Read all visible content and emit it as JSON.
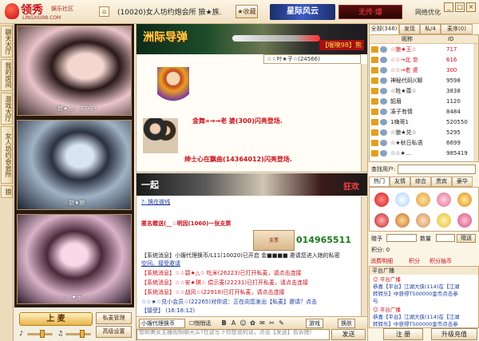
{
  "header": {
    "logo_main": "领秀",
    "logo_sub": "娱乐社区",
    "logo_url": "LINGXIU98.COM",
    "room_title": "(10020)女人坊约炮会所  狼★族.",
    "fav_label": "收藏",
    "banner_text": "星际风云",
    "live_text": "无传·爆",
    "net_label": "网络优化",
    "minimize": "_",
    "maximize": "□",
    "close": "×"
  },
  "vtabs": [
    "聊天大厅",
    "我的房间",
    "游戏大厅",
    "女人坊约会会所",
    "狼"
  ],
  "videos": [
    {
      "caption": "☆新★△☆  求守护"
    },
    {
      "caption": "☆旅★娘"
    },
    {
      "caption": "☆☆★乐☆"
    }
  ],
  "mic": {
    "up_label": "上 麦",
    "manage_label": "私麦管理",
    "settings_label": "高级设置"
  },
  "middle": {
    "banner_title": "洲际导弹",
    "banner_tag": "【喔噢98】熊",
    "pub_header": "☆☆叶★子☆(24566)",
    "pub_msg1": "金舞∝→→老 婆(300)闪亮登场.",
    "pub_msg2": "绅士心在飘曲(14364012)闪亮登场.",
    "banner2_title": "一起",
    "banner2_tag": "狂欢"
  },
  "chat": {
    "lines": [
      {
        "text": "?: 换在彼线"
      },
      {
        "text": "匿名赠送(__☆明因(1060)一张支票"
      },
      {
        "text": "【系统消息】小嫂代理换币/L11(10020)已开启 金■■■■ 邀请您进入她的私密"
      },
      {
        "text": "空间。接受邀请"
      },
      {
        "text": "【系统消息】☆☆碧★△☆ 吃米(26223)已打开私麦，请点击连接"
      },
      {
        "text": "【系统消息】☆☆安★琪☆ 偿示麦(22231)已打开私麦，请点击连接"
      },
      {
        "text": "【系统消息】☆☆战风☆(22918)已打开私麦，请点击连接"
      },
      {
        "text": "☆☆★☆兑小会员☆(22265)对你说：正在向您发出【私麦】邀请？点击"
      },
      {
        "text": "【接受】 (16:18:12)"
      }
    ],
    "money_text": "支票",
    "qq_number": "014965511"
  },
  "toolbar": {
    "target_select": "小嫂代理换币",
    "private_check": "悄悄话",
    "game_label": "游戏",
    "switch_label": "换肤"
  },
  "input": {
    "placeholder": "想和美女主播视频聊天么?在这写下你想说的话，点击【发送】告诉她!",
    "send_label": "发送"
  },
  "right": {
    "tabs": [
      "全部(348)",
      "发现",
      "私/4",
      "麦序(0)"
    ],
    "list_head_name": "昵称",
    "list_head_id": "ID",
    "users": [
      {
        "name": "☆狼★王☆",
        "id": "717"
      },
      {
        "name": "☆☆→北 京",
        "id": "616"
      },
      {
        "name": "☆☆→老 婆",
        "id": "300"
      },
      {
        "name": "神秘代码)(聊",
        "id": "9598"
      },
      {
        "name": "☆姓★尊☆",
        "id": "3838"
      },
      {
        "name": "韶眉",
        "id": "1120"
      },
      {
        "name": "凑子有情",
        "id": "8484"
      },
      {
        "name": "1嗨哥1",
        "id": "520550"
      },
      {
        "name": "☆狼★兑☆",
        "id": "5295"
      },
      {
        "name": "☆★秋日私语",
        "id": "6699"
      },
      {
        "name": "☆☆★...",
        "id": "985419"
      }
    ],
    "search_label": "查找用户:",
    "gift_tabs": [
      "热门",
      "友情",
      "综合",
      "贵宾",
      "豪华"
    ],
    "gift_qty_label": "数量",
    "gift_to_label": "赠予",
    "gift_send": "赠送",
    "gift_coin_label": "积分: 0",
    "links": [
      "消费明细",
      "积分",
      "积分抽币"
    ],
    "broadcast_head": "平台广播",
    "broadcast": [
      "☺ 平台广播",
      "恭喜【平台】江湖大侠(114)在【江湖",
      "转转乐】中获得T500000金币点击参",
      "与",
      "☺ 平台广播",
      "恭喜【平台】江湖大侠(114)在【江湖",
      "转转乐】中获得T500000金币点击参"
    ],
    "register_label": "注 册",
    "upgrade_label": "升级充值"
  }
}
